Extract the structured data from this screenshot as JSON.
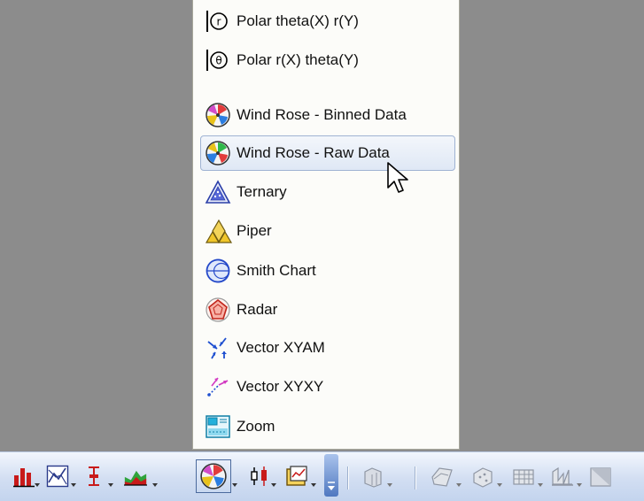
{
  "menu": {
    "items": [
      {
        "label": "Polar theta(X) r(Y)",
        "icon": "polar-theta-x-icon"
      },
      {
        "label": "Polar r(X) theta(Y)",
        "icon": "polar-r-x-icon"
      },
      {
        "label": "Wind Rose - Binned Data",
        "icon": "wind-rose-binned-icon"
      },
      {
        "label": "Wind Rose - Raw Data",
        "icon": "wind-rose-raw-icon"
      },
      {
        "label": "Ternary",
        "icon": "ternary-icon"
      },
      {
        "label": "Piper",
        "icon": "piper-icon"
      },
      {
        "label": "Smith Chart",
        "icon": "smith-chart-icon"
      },
      {
        "label": "Radar",
        "icon": "radar-icon"
      },
      {
        "label": "Vector XYAM",
        "icon": "vector-xyam-icon"
      },
      {
        "label": "Vector  XYXY",
        "icon": "vector-xyxy-icon"
      },
      {
        "label": "Zoom",
        "icon": "zoom-icon"
      }
    ],
    "hovered_item": "Wind Rose - Raw Data"
  },
  "toolbar": {
    "buttons": [
      "bar-chart-icon",
      "line-chart-icon",
      "error-bar-chart-icon",
      "area-chart-icon",
      "wind-rose-icon",
      "candlestick-icon",
      "table-plot-icon",
      "overflow-arrow-icon",
      "3d-bar-icon",
      "3d-surface-icon",
      "3d-scatter-icon",
      "3d-wall-icon",
      "3d-histogram-icon",
      "3d-cube-icon"
    ]
  },
  "colors": {
    "background": "#8c8c8c",
    "menu_background": "#fcfcf9",
    "hover_border": "#9fb3d3",
    "toolbar_gradient_top": "#f2f6fd",
    "toolbar_gradient_bottom": "#c3d4ee"
  }
}
